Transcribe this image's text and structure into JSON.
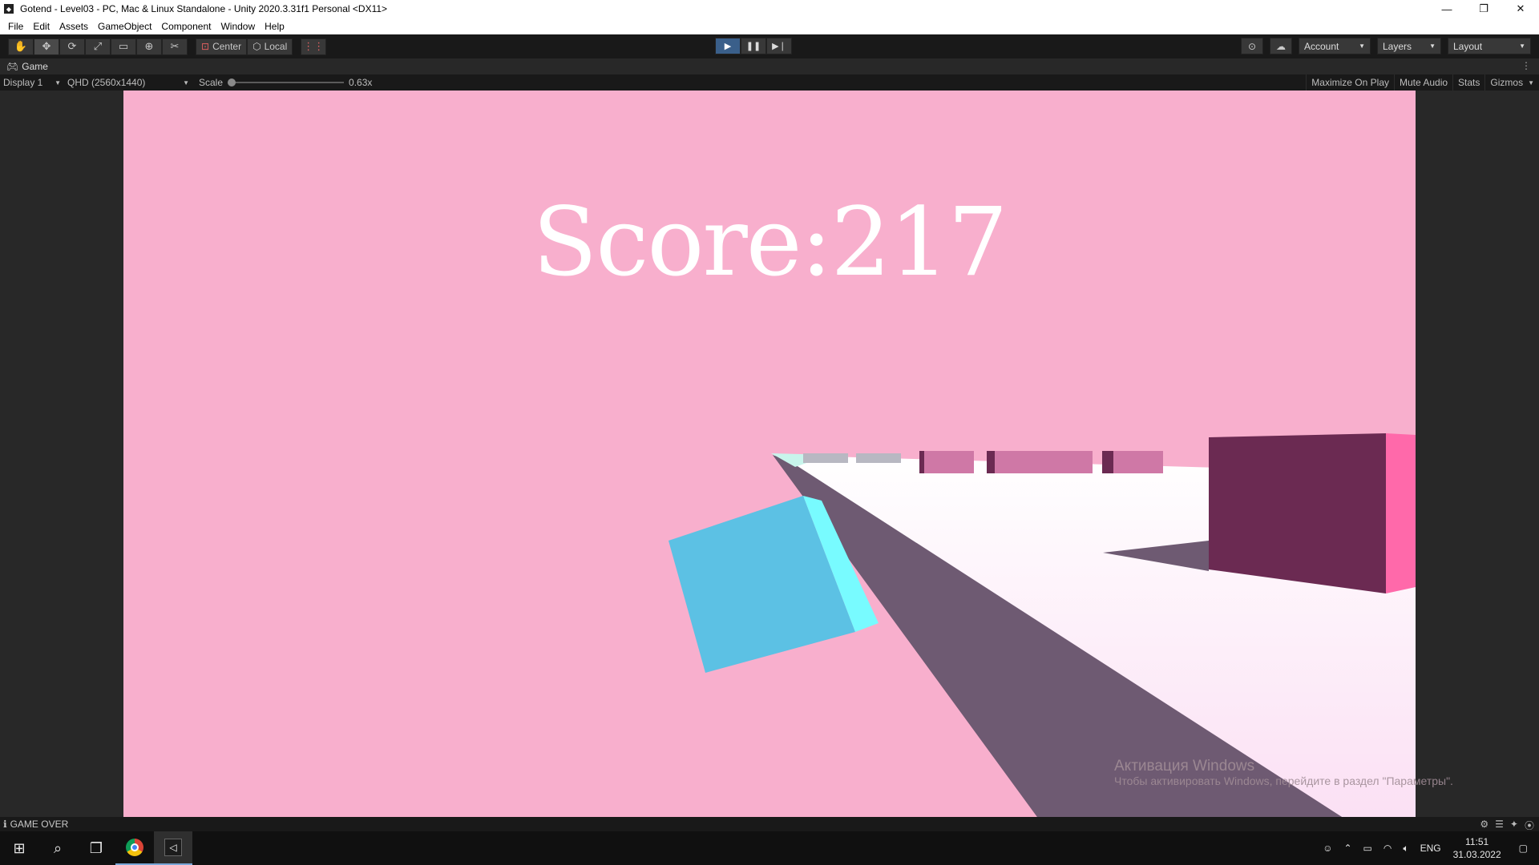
{
  "window": {
    "title": "Gotend - Level03 - PC, Mac & Linux Standalone - Unity 2020.3.31f1 Personal <DX11>",
    "minimize": "—",
    "restore": "❐",
    "close": "✕"
  },
  "menu": [
    "File",
    "Edit",
    "Assets",
    "GameObject",
    "Component",
    "Window",
    "Help"
  ],
  "toolbar": {
    "pivot_center": "Center",
    "pivot_local": "Local",
    "account": "Account",
    "layers": "Layers",
    "layout": "Layout"
  },
  "game_tab": {
    "label": "Game",
    "display": "Display 1",
    "resolution": "QHD (2560x1440)",
    "scale_label": "Scale",
    "scale_value": "0.63x",
    "maximize_on_play": "Maximize On Play",
    "mute_audio": "Mute Audio",
    "stats": "Stats",
    "gizmos": "Gizmos"
  },
  "game": {
    "score_label": "Score:",
    "score_value": "217"
  },
  "watermark": {
    "title": "Активация Windows",
    "subtitle": "Чтобы активировать Windows, перейдите в раздел \"Параметры\"."
  },
  "status": {
    "message": "GAME OVER"
  },
  "taskbar": {
    "language": "ENG",
    "time": "11:51",
    "date": "31.03.2022"
  },
  "colors": {
    "sky": "#f8afcd",
    "floor": "#ffffff",
    "player_cube": "#5cc1e4",
    "obstacle_dark": "#6b2a52",
    "obstacle_light": "#cf78a6",
    "score_text": "#ffffff"
  }
}
